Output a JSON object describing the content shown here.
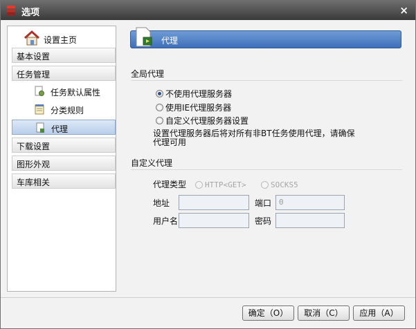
{
  "window": {
    "title": "选项",
    "close_glyph": "×"
  },
  "sidebar": {
    "home_label": "设置主页",
    "items": [
      {
        "label": "基本设置",
        "type": "group"
      },
      {
        "label": "任务管理",
        "type": "group"
      },
      {
        "label": "任务默认属性",
        "type": "sub"
      },
      {
        "label": "分类规则",
        "type": "sub"
      },
      {
        "label": "代理",
        "type": "sub",
        "active": true
      },
      {
        "label": "下载设置",
        "type": "group"
      },
      {
        "label": "图形外观",
        "type": "group"
      },
      {
        "label": "车库相关",
        "type": "group"
      }
    ]
  },
  "main": {
    "header_title": "代理",
    "global_proxy": {
      "section_title": "全局代理",
      "options": [
        {
          "label": "不使用代理服务器",
          "checked": true
        },
        {
          "label": "使用IE代理服务器",
          "checked": false
        },
        {
          "label": "自定义代理服务器设置",
          "checked": false
        }
      ],
      "note": "设置代理服务器后将对所有非BT任务使用代理，请确保代理可用"
    },
    "custom_proxy": {
      "section_title": "自定义代理",
      "proxy_type_label": "代理类型",
      "type_options": [
        "HTTP<GET>",
        "SOCKS5"
      ],
      "address_label": "地址",
      "port_label": "端口",
      "port_value": "0",
      "username_label": "用户名",
      "password_label": "密码"
    }
  },
  "footer": {
    "ok_label": "确定（O）",
    "cancel_label": "取消（C）",
    "apply_label": "应用（A）"
  }
}
